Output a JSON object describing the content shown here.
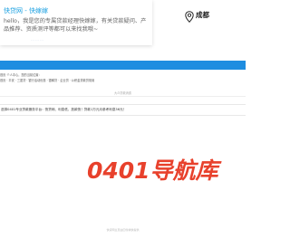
{
  "chat": {
    "title": "快贷网 - 快嫁嫁",
    "message": "hello，我是您的专属贷款经理快嫁嫁，有关贷款疑问、产品推荐、资质测评等都可以来找我哦~",
    "faint_line": "………"
  },
  "location": {
    "label": "成都",
    "icon": "map-pin-icon"
  },
  "nav": {
    "bar_color": "#1e8de0",
    "row1": "首页 个人中心，您的当前位置：",
    "row2": "首页 · 平安 · 三菱贷 · 银行活动优惠 · 银稀贷 · 企业贷 · 公积金贷款贷常用"
  },
  "sub_caption": "大众贷款消费",
  "banner": {
    "text": "选择0401专业贷款服务平台：快贷网、利息低、放款快！贷款1万元月参考利息36元！"
  },
  "logo": {
    "text": "0401导航库",
    "color": "#e8412c"
  },
  "footer": {
    "text": "快贷网主页由四零捕快提供"
  }
}
